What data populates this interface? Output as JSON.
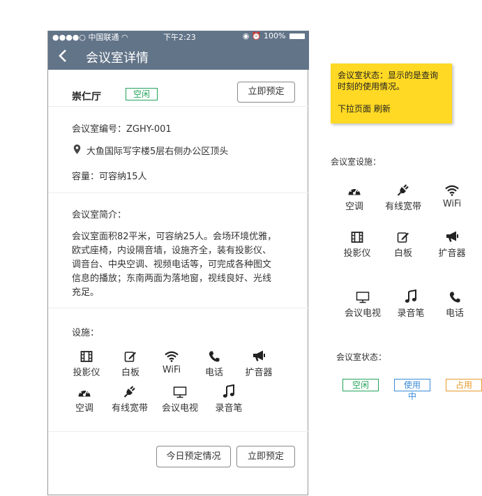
{
  "status": {
    "carrier": "●●●●○ 中国联通 ",
    "time": "下午2:23",
    "battery": "100%"
  },
  "nav": {
    "title": "会议室详情"
  },
  "room": {
    "name": "崇仁厅",
    "state": "空闲",
    "book_label": "立即预定"
  },
  "info": {
    "number": "会议室编号：ZGHY-001",
    "location": "大鱼国际写字楼5层右侧办公区顶头",
    "capacity": "容量：可容纳15人"
  },
  "intro": {
    "title": "会议室简介：",
    "lines": [
      "会议室面积82平米，可容纳25人。会场环境优雅，",
      "欧式座椅，内设隔音墙，设施齐全，装有投影仪、",
      "调音台、中央空调、视频电话等，可完成各种图文",
      "信息的播放；东南两面为落地窗，视线良好、光线",
      "充足。"
    ]
  },
  "facilities": {
    "title": "设施：",
    "items": [
      {
        "label": "投影仪",
        "icon": "projector-icon"
      },
      {
        "label": "白板",
        "icon": "whiteboard-icon"
      },
      {
        "label": "WiFi",
        "icon": "wifi-icon"
      },
      {
        "label": "电话",
        "icon": "phone-icon"
      },
      {
        "label": "扩音器",
        "icon": "megaphone-icon"
      },
      {
        "label": "空调",
        "icon": "air-conditioner-icon"
      },
      {
        "label": "有线宽带",
        "icon": "plug-icon"
      },
      {
        "label": "会议电视",
        "icon": "monitor-icon"
      },
      {
        "label": "录音笔",
        "icon": "music-note-icon"
      }
    ]
  },
  "footer": {
    "today_label": "今日预定情况",
    "book_label": "立即预定"
  },
  "note": {
    "line1": "会议室状态：显示的是查询",
    "line2": "时刻的使用情况。",
    "line3": "下拉页面  刷新"
  },
  "legend": {
    "facilities_title": "会议室设施：",
    "items": [
      {
        "label": "空调",
        "icon": "air-conditioner-icon"
      },
      {
        "label": "有线宽带",
        "icon": "plug-icon"
      },
      {
        "label": "WiFi",
        "icon": "wifi-icon"
      },
      {
        "label": "投影仪",
        "icon": "projector-icon"
      },
      {
        "label": "白板",
        "icon": "whiteboard-icon"
      },
      {
        "label": "扩音器",
        "icon": "megaphone-icon"
      },
      {
        "label": "会议电视",
        "icon": "monitor-icon"
      },
      {
        "label": "录音笔",
        "icon": "music-note-icon"
      },
      {
        "label": "电话",
        "icon": "phone-icon"
      }
    ],
    "status_title": "会议室状态：",
    "status": {
      "free": "空闲",
      "in_use": "使用中",
      "occupied": "占用"
    }
  },
  "colors": {
    "nav_bg": "#627488",
    "free": "#23a35a",
    "in_use": "#3a8ad8",
    "occupied": "#e79a2a",
    "note_bg": "#ffd923"
  }
}
